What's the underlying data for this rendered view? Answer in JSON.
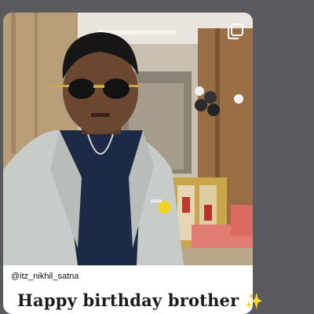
{
  "post": {
    "username": "@itz_nikhil_satna",
    "caption": "Happy birthday brother",
    "caption_emoji": "✨",
    "media_icon": "multiple-images-icon"
  },
  "photo": {
    "subject": "person-photo"
  },
  "colors": {
    "page_background": "#5a5a5e",
    "card_background": "#ffffff",
    "sparkle": "#f5c518"
  }
}
